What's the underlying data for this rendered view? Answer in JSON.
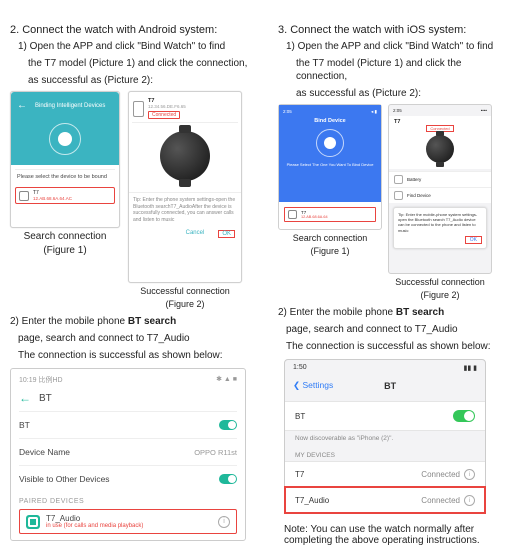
{
  "left": {
    "heading": "2. Connect the watch with Android system:",
    "step1a": "1) Open the APP and click \"Bind Watch\" to find",
    "step1b": "the T7 model (Picture 1) and click the connection,",
    "step1c": "as successful as (Picture 2):",
    "fig1": {
      "header": "Binding Intelligent Devices",
      "select": "Please select the device to be bound",
      "dev_name": "T7",
      "dev_mac": "12.AB.68.6A.64.AC",
      "caption1": "Search connection",
      "caption2": "(Figure 1)"
    },
    "fig2": {
      "dev_name": "T7",
      "dev_mac": "12.34.56.DE.F6.65",
      "connected": "Connected",
      "tip": "Tip: Enter the phone system settings-open the Bluetooth searchT7_AudioAfter the device is successfully connected, you can answer calls and listen to music",
      "cancel": "Cancel",
      "ok": "OK",
      "caption1": "Successful connection",
      "caption2": "(Figure 2)"
    },
    "step2a": "2) Enter the mobile phone ",
    "step2a_bold": "BT search",
    "step2b": "page, search and connect to T7_Audio",
    "step2c": "The connection is successful as shown below:",
    "bt": {
      "status_left": "10:19  比例HD",
      "status_icons": "✱ ▲ ■",
      "title": "BT",
      "row_bt": "BT",
      "row_name": "Device Name",
      "row_name_val": "OPPO R11st",
      "row_visible": "Visible to Other Devices",
      "section": "PAIRED DEVICES",
      "paired_name": "T7_Audio",
      "paired_sub": "in use (for calls and media playback)"
    }
  },
  "right": {
    "heading": "3. Connect the watch with iOS system:",
    "step1a": "1) Open the APP and click \"Bind Watch\" to find",
    "step1b": "the T7 model (Picture 1) and click the connection,",
    "step1c": "as successful as (Picture 2):",
    "fig1": {
      "time": "2:05",
      "title": "Bind Device",
      "subtitle": "Please Select The One You Want To Bind Device",
      "dev_name": "T7",
      "dev_mac": "12.AB.68.6A.64",
      "caption1": "Search connection",
      "caption2": "(Figure 1)"
    },
    "fig2": {
      "time": "2:05",
      "dots": "••••",
      "dev_name": "T7",
      "connected": "Connected",
      "menu_battery": "Battery",
      "menu_find": "Find Device",
      "tip": "Tip: Enter the mobile-phone system settings-open the Bluetooth search   T7_Audio device can be connected to the phone and listen to music",
      "ok": "OK",
      "caption1": "Successful connection",
      "caption2": "(Figure 2)"
    },
    "step2a": "2) Enter the mobile phone ",
    "step2a_bold": "BT search",
    "step2b": "page, search and connect to T7_Audio",
    "step2c": "The connection is successful as shown below:",
    "bt": {
      "time": "1:50",
      "back": "Settings",
      "title": "BT",
      "row_bt": "BT",
      "disc": "Now discoverable as \"iPhone (2)\".",
      "section": "MY DEVICES",
      "dev1": "T7",
      "dev1_status": "Connected",
      "dev2": "T7_Audio",
      "dev2_status": "Connected"
    },
    "note1": "Note: You can use the watch normally after",
    "note2": "completing the above operating instructions."
  }
}
